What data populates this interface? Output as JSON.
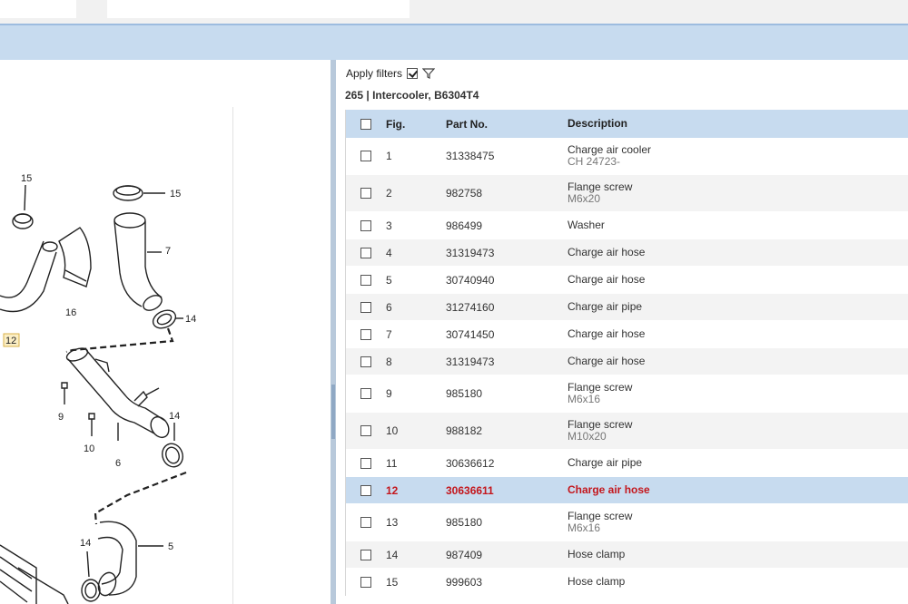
{
  "filters": {
    "label": "Apply filters",
    "checked": true
  },
  "section": {
    "number": "265",
    "separator": "|",
    "title": "Intercooler, B6304T4"
  },
  "table": {
    "headers": {
      "fig": "Fig.",
      "part": "Part No.",
      "desc": "Description"
    },
    "rows": [
      {
        "fig": "1",
        "part": "31338475",
        "desc": "Charge air cooler",
        "sub": "CH 24723-"
      },
      {
        "fig": "2",
        "part": "982758",
        "desc": "Flange screw",
        "sub": "M6x20"
      },
      {
        "fig": "3",
        "part": "986499",
        "desc": "Washer",
        "sub": ""
      },
      {
        "fig": "4",
        "part": "31319473",
        "desc": "Charge air hose",
        "sub": ""
      },
      {
        "fig": "5",
        "part": "30740940",
        "desc": "Charge air hose",
        "sub": ""
      },
      {
        "fig": "6",
        "part": "31274160",
        "desc": "Charge air pipe",
        "sub": ""
      },
      {
        "fig": "7",
        "part": "30741450",
        "desc": "Charge air hose",
        "sub": ""
      },
      {
        "fig": "8",
        "part": "31319473",
        "desc": "Charge air hose",
        "sub": ""
      },
      {
        "fig": "9",
        "part": "985180",
        "desc": "Flange screw",
        "sub": "M6x16"
      },
      {
        "fig": "10",
        "part": "988182",
        "desc": "Flange screw",
        "sub": "M10x20"
      },
      {
        "fig": "11",
        "part": "30636612",
        "desc": "Charge air pipe",
        "sub": ""
      },
      {
        "fig": "12",
        "part": "30636611",
        "desc": "Charge air hose",
        "sub": "",
        "selected": true
      },
      {
        "fig": "13",
        "part": "985180",
        "desc": "Flange screw",
        "sub": "M6x16"
      },
      {
        "fig": "14",
        "part": "987409",
        "desc": "Hose clamp",
        "sub": ""
      },
      {
        "fig": "15",
        "part": "999603",
        "desc": "Hose clamp",
        "sub": ""
      }
    ]
  },
  "diagram": {
    "labels": [
      "15",
      "15",
      "7",
      "16",
      "14",
      "12",
      "9",
      "10",
      "6",
      "14",
      "5",
      "14"
    ],
    "highlighted": "12"
  },
  "colors": {
    "header_bg": "#c7dbef",
    "selected_text": "#c4161c"
  }
}
